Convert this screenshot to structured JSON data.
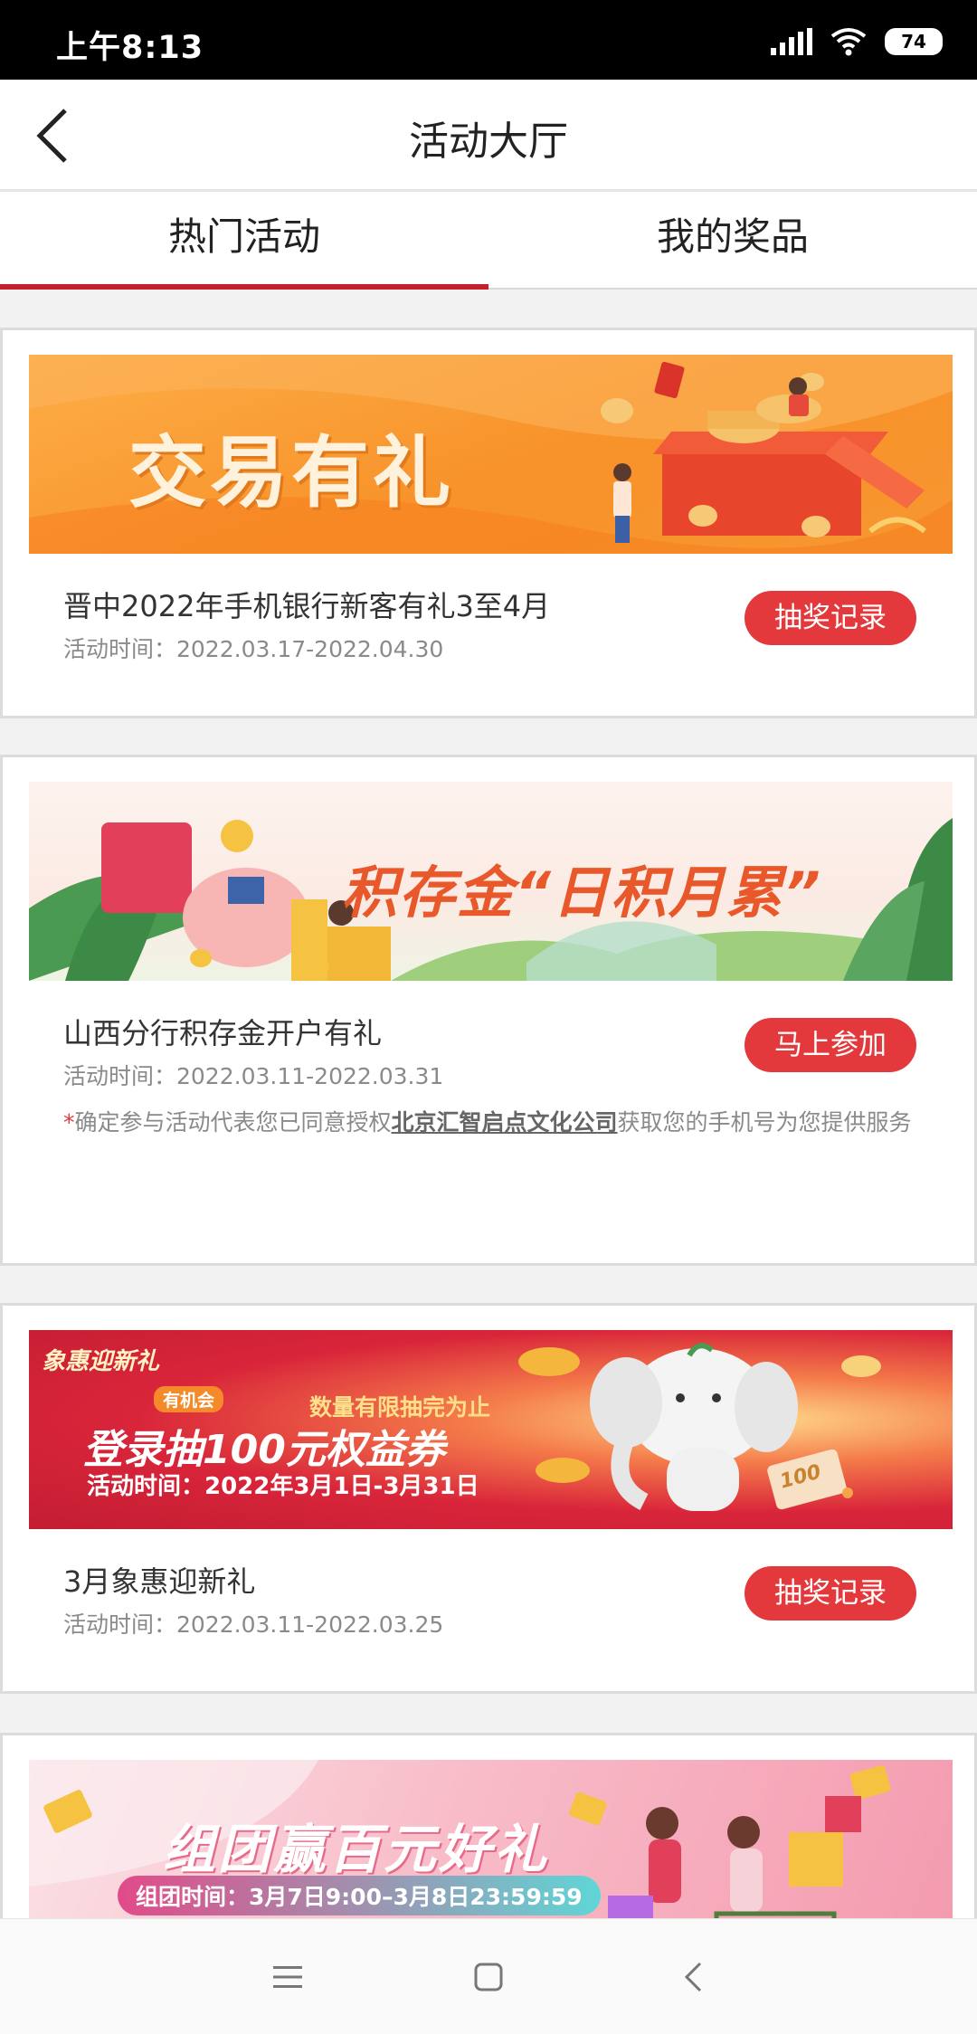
{
  "status_bar": {
    "time": "上午8:13",
    "battery": "74"
  },
  "header": {
    "title": "活动大厅"
  },
  "tabs": [
    {
      "label": "热门活动",
      "active": true
    },
    {
      "label": "我的奖品",
      "active": false
    }
  ],
  "cards": [
    {
      "banner": {
        "headline": "交易有礼"
      },
      "title": "晋中2022年手机银行新客有礼3至4月",
      "time": "活动时间：2022.03.17-2022.04.30",
      "button": "抽奖记录"
    },
    {
      "banner": {
        "headline": "积存金“日积月累”"
      },
      "title": "山西分行积存金开户有礼",
      "time": "活动时间：2022.03.11-2022.03.31",
      "button": "马上参加",
      "note": {
        "star": "*",
        "prefix": "确定参与活动代表您已同意授权",
        "company": "北京汇智启点文化公司",
        "suffix": "获取您的手机号为您提供服务"
      }
    },
    {
      "banner": {
        "logo": "象惠迎新礼",
        "badge": "有机会",
        "limit": "数量有限抽完为止",
        "headline": "登录抽100元权益券",
        "time": "活动时间：2022年3月1日-3月31日",
        "coupon": "100"
      },
      "title": "3月象惠迎新礼",
      "time": "活动时间：2022.03.11-2022.03.25",
      "button": "抽奖记录"
    },
    {
      "banner": {
        "headline": "组团赢百元好礼",
        "time": "组团时间：3月7日9:00–3月8日23:59:59"
      }
    }
  ],
  "colors": {
    "accent": "#c5202c",
    "button": "#e4393c"
  },
  "icons": {
    "back": "chevron-left-icon",
    "wifi": "wifi-icon",
    "signal": "signal-icon",
    "nav_menu": "menu-icon",
    "nav_home": "square-icon",
    "nav_back": "back-triangle-icon"
  }
}
